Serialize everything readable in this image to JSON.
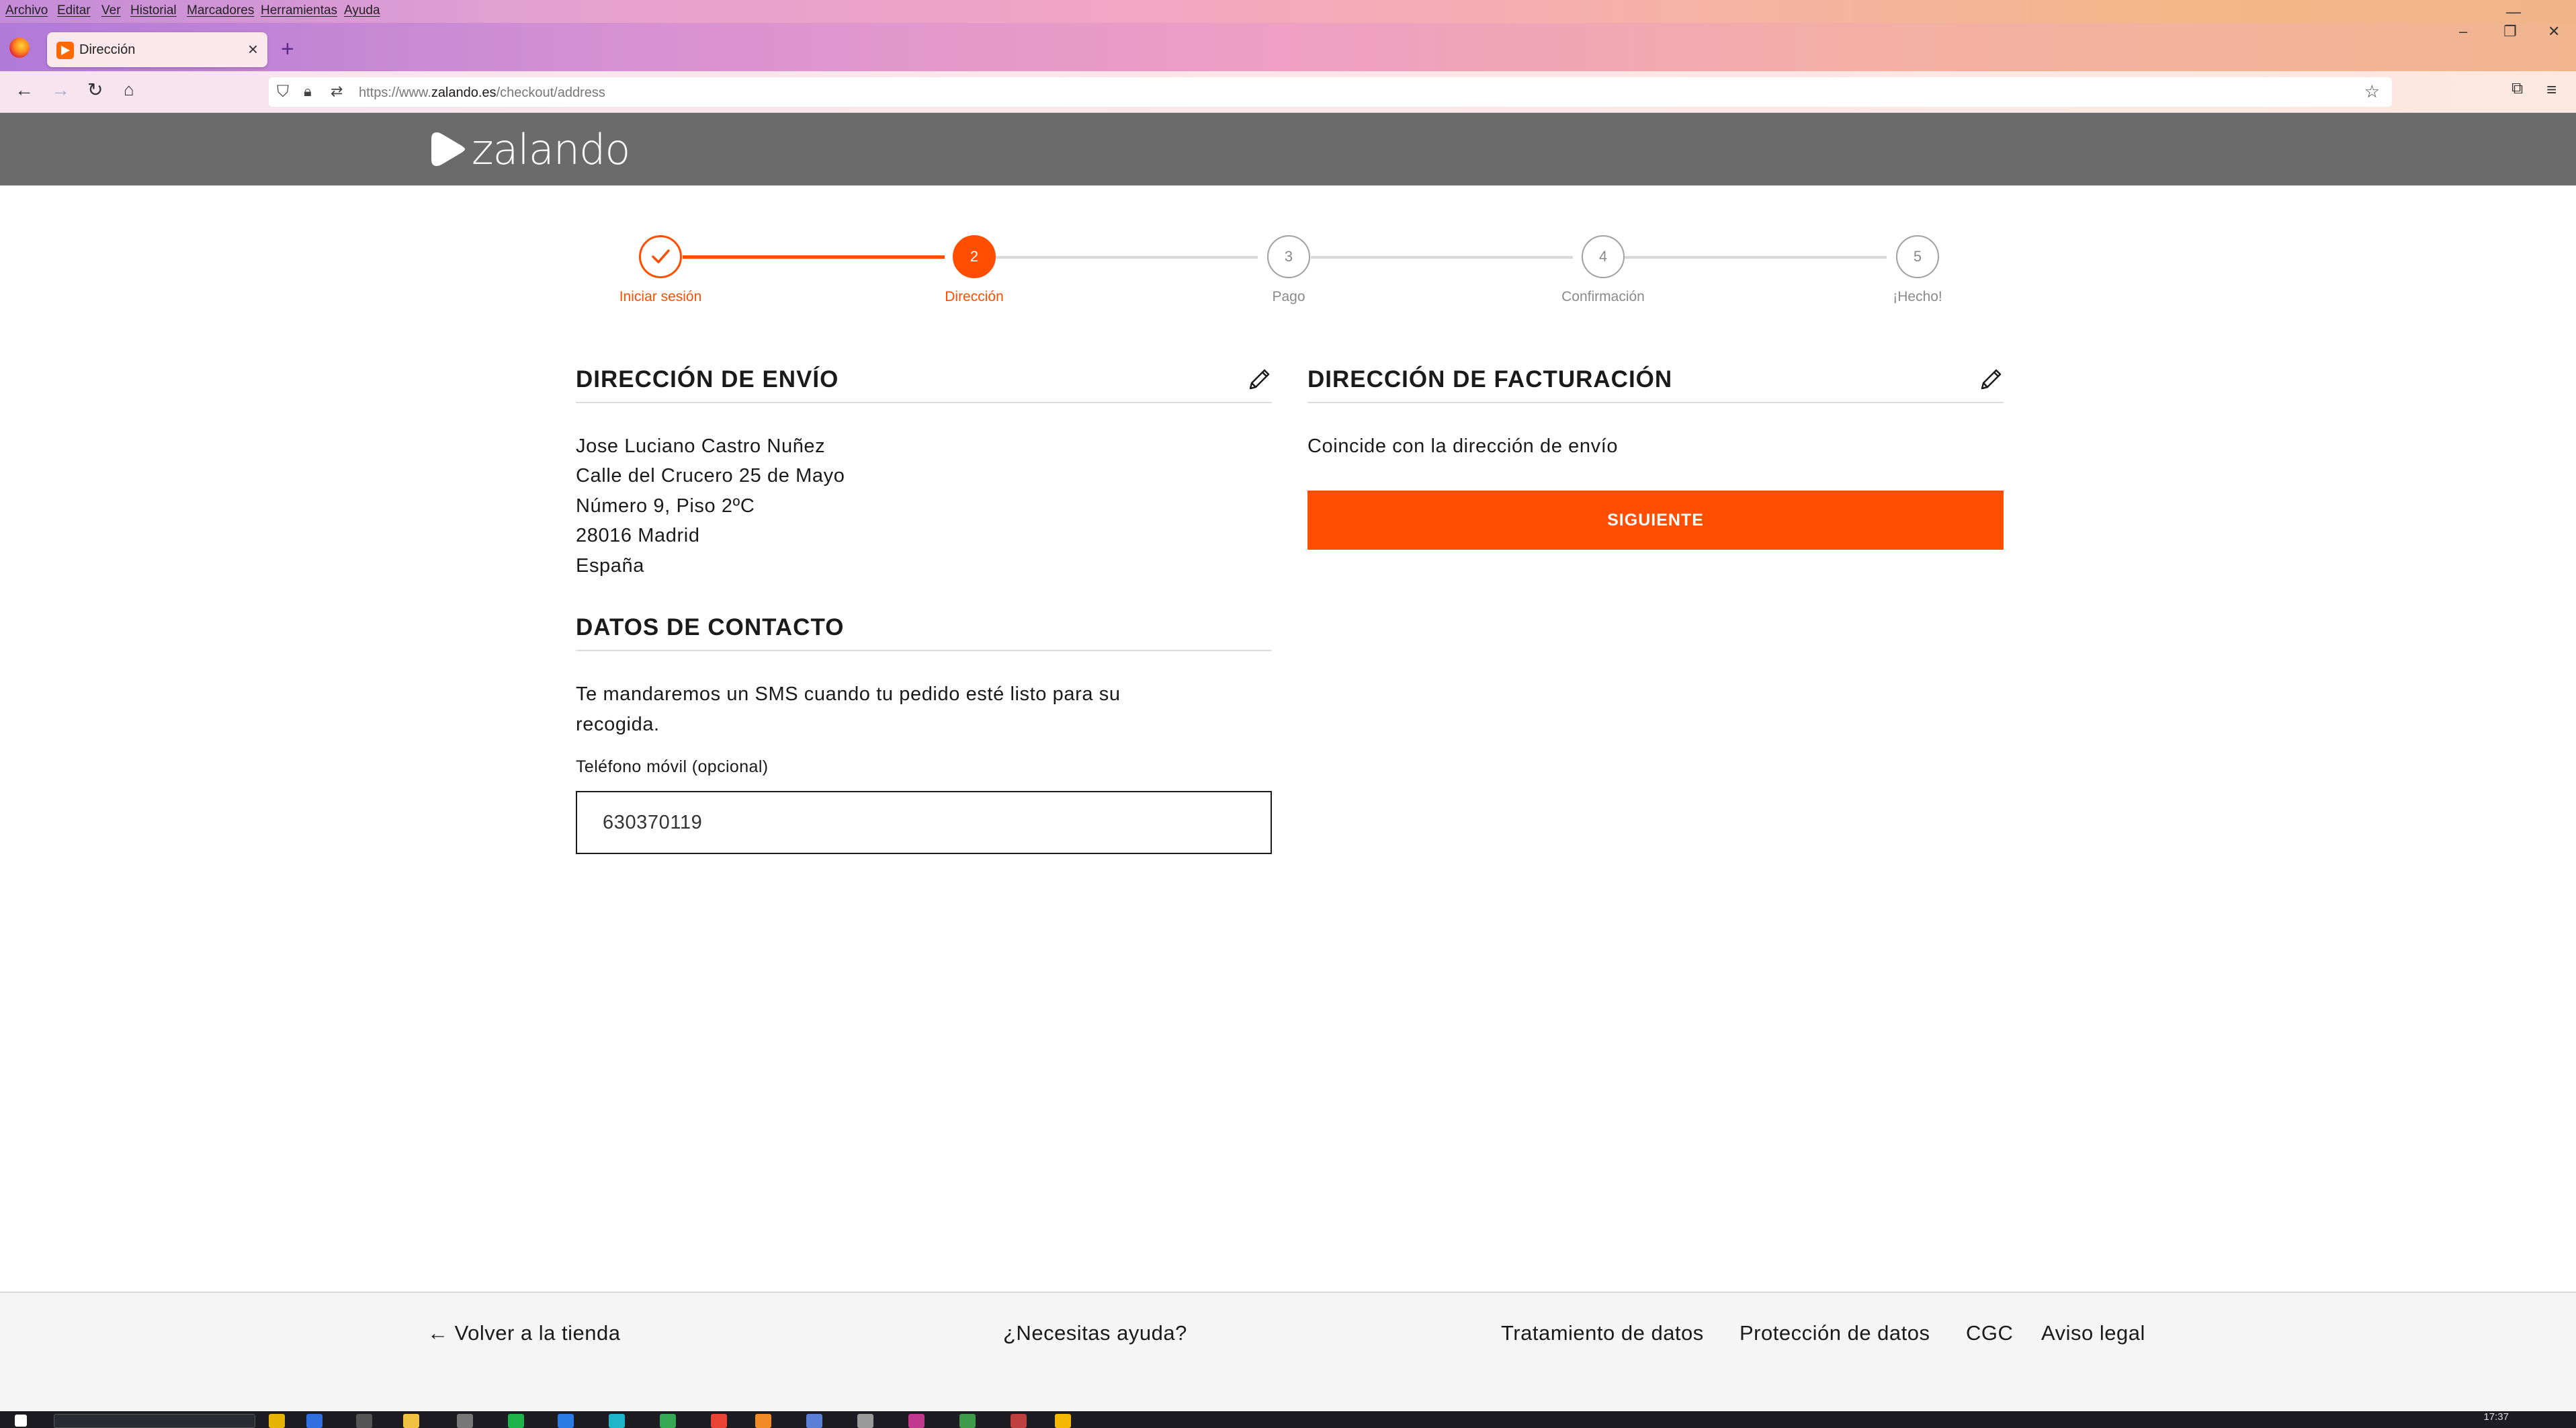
{
  "browser": {
    "menu": [
      "Archivo",
      "Editar",
      "Ver",
      "Historial",
      "Marcadores",
      "Herramientas",
      "Ayuda"
    ],
    "tab_title": "Dirección",
    "url_prefix": "https://www.",
    "url_host": "zalando.es",
    "url_path": "/checkout/address"
  },
  "header": {
    "logo_text": "zalando"
  },
  "steps": [
    {
      "number": "",
      "label": "Iniciar sesión",
      "state": "done"
    },
    {
      "number": "2",
      "label": "Dirección",
      "state": "active"
    },
    {
      "number": "3",
      "label": "Pago",
      "state": "pending"
    },
    {
      "number": "4",
      "label": "Confirmación",
      "state": "pending"
    },
    {
      "number": "5",
      "label": "¡Hecho!",
      "state": "pending"
    }
  ],
  "shipping": {
    "title": "DIRECCIÓN DE ENVÍO",
    "lines": [
      "Jose Luciano Castro Nuñez",
      "Calle del Crucero 25 de Mayo",
      "Número 9, Piso 2ºC",
      "28016 Madrid",
      "España"
    ]
  },
  "billing": {
    "title": "DIRECCIÓN DE FACTURACIÓN",
    "note": "Coincide con la dirección de envío",
    "next_button": "SIGUIENTE"
  },
  "contact": {
    "title": "DATOS DE CONTACTO",
    "description_line1": "Te mandaremos un SMS cuando tu pedido esté listo para su",
    "description_line2": "recogida.",
    "phone_label": "Teléfono móvil (opcional)",
    "phone_value": "630370119"
  },
  "footer": {
    "back": "Volver a la tienda",
    "help": "¿Necesitas ayuda?",
    "links": [
      "Tratamiento de datos",
      "Protección de datos",
      "CGC",
      "Aviso legal"
    ]
  },
  "taskbar": {
    "time": "17:37"
  },
  "colors": {
    "accent": "#ff4e00",
    "header_bg": "#6b6b6b"
  }
}
